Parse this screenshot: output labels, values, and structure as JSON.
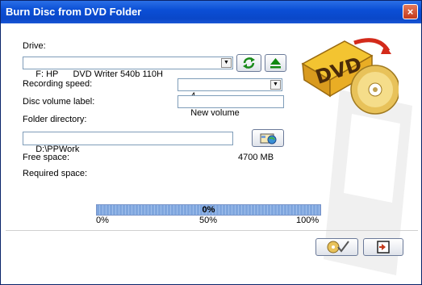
{
  "window": {
    "title": "Burn Disc from DVD Folder",
    "close_label": "×"
  },
  "drive": {
    "label": "Drive:",
    "value": "F: HP      DVD Writer 540b 110H"
  },
  "recording_speed": {
    "label": "Recording speed:",
    "value": "4"
  },
  "volume_label": {
    "label": "Disc volume label:",
    "value": "New volume"
  },
  "folder": {
    "label": "Folder directory:",
    "value": "D:\\PPWork"
  },
  "free_space": {
    "label": "Free space:",
    "value": "4700 MB"
  },
  "required_space": {
    "label": "Required space:"
  },
  "progress": {
    "percent_text": "0%",
    "value": 0,
    "ticks": [
      "0%",
      "50%",
      "100%"
    ]
  },
  "logo_text": "DVD",
  "icons": [
    "refresh-icon",
    "eject-icon",
    "browse-folder-icon",
    "burn-icon",
    "exit-icon"
  ]
}
